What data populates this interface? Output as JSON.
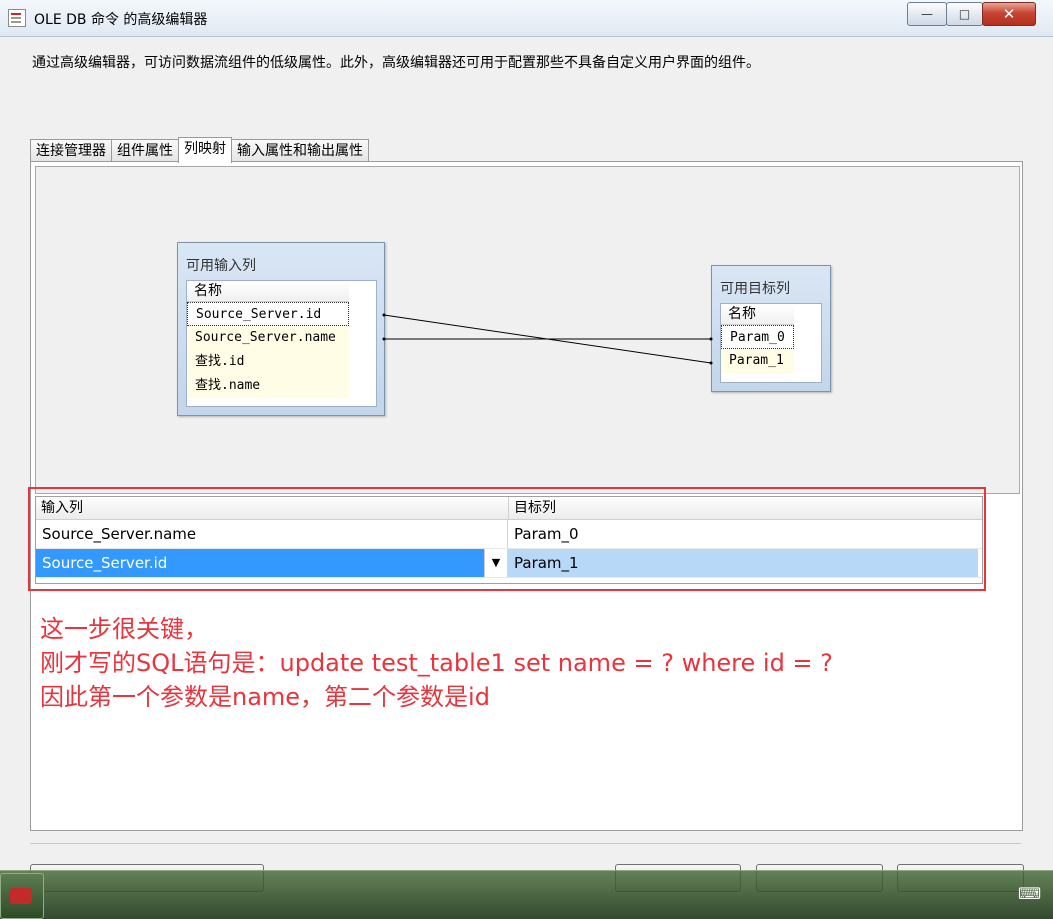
{
  "window": {
    "title": "OLE DB 命令 的高级编辑器",
    "minimize_glyph": "—",
    "maximize_glyph": "□",
    "close_glyph": "✕"
  },
  "description": "通过高级编辑器，可访问数据流组件的低级属性。此外，高级编辑器还可用于配置那些不具备自定义用户界面的组件。",
  "tabs": [
    {
      "label": "连接管理器"
    },
    {
      "label": "组件属性"
    },
    {
      "label": "列映射"
    },
    {
      "label": "输入属性和输出属性"
    }
  ],
  "input_box": {
    "title": "可用输入列",
    "header": "名称",
    "items": [
      "Source_Server.id",
      "Source_Server.name",
      "查找.id",
      "查找.name"
    ]
  },
  "target_box": {
    "title": "可用目标列",
    "header": "名称",
    "items": [
      "Param_0",
      "Param_1"
    ]
  },
  "mapping_grid": {
    "headers": [
      "输入列",
      "目标列"
    ],
    "rows": [
      {
        "input": "Source_Server.name",
        "target": "Param_0"
      },
      {
        "input": "Source_Server.id",
        "target": "Param_1"
      }
    ],
    "dropdown_glyph": "▼"
  },
  "annotation": {
    "lines": [
      "这一步很关键，",
      "刚才写的SQL语句是：update test_table1 set name = ? where id = ?",
      "因此第一个参数是name，第二个参数是id"
    ],
    "color": "#e8353d"
  },
  "taskbar": {
    "keyboard_glyph": "⌨"
  }
}
